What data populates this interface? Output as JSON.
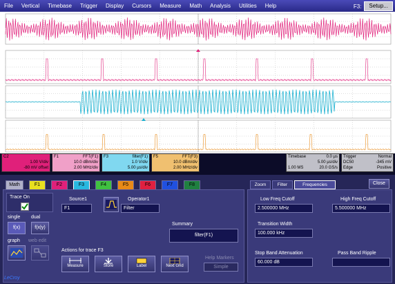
{
  "menu": [
    "File",
    "Vertical",
    "Timebase",
    "Trigger",
    "Display",
    "Cursors",
    "Measure",
    "Math",
    "Analysis",
    "Utilities",
    "Help"
  ],
  "setup": {
    "prefix": "F3:",
    "label": "Setup..."
  },
  "channels": [
    {
      "id": "C2",
      "color": "#e0207a"
    },
    {
      "id": "F1",
      "color": "#e0207a"
    },
    {
      "id": "F3",
      "color": "#18b0d0"
    },
    {
      "id": "F5",
      "color": "#e88a18"
    }
  ],
  "desc_boxes": [
    {
      "id": "C2",
      "title": "",
      "vals": [
        "1.00 V/div",
        "-80 mV offset"
      ],
      "color": "#e0207a",
      "text": "#000"
    },
    {
      "id": "F1",
      "title": "FFT(F1)",
      "vals": [
        "10.0 dBm/div",
        "2.00 MHz/div"
      ],
      "color": "#f0a0c8",
      "text": "#000"
    },
    {
      "id": "F3",
      "title": "filter(F1)",
      "vals": [
        "1.0 V/div",
        "5.00 µs/div"
      ],
      "color": "#80d8f0",
      "text": "#000"
    },
    {
      "id": "F5",
      "title": "FFT(F3)",
      "vals": [
        "10.0 dBm/div",
        "2.00 MHz/div"
      ],
      "color": "#f0c070",
      "text": "#000"
    }
  ],
  "timebase": {
    "label": "Timebase",
    "rows": [
      [
        "",
        "0.0 µs"
      ],
      [
        "",
        "5.00 µs/div"
      ],
      [
        "1.00 MS",
        "20.0 GS/s"
      ]
    ]
  },
  "trigger": {
    "label": "Trigger",
    "mode": "Normal",
    "rows": [
      [
        "DC50",
        "-345 mV"
      ],
      [
        "Edge",
        "Positive"
      ]
    ]
  },
  "dialog": {
    "tabs": [
      "Math",
      "F1",
      "F2",
      "F3",
      "F4",
      "F5",
      "F6",
      "F7",
      "F8"
    ],
    "trace_on": {
      "label": "Trace On",
      "checked": true
    },
    "single_label": "single",
    "dual_label": "dual",
    "graph_label": "graph",
    "web_edit_label": "web edit",
    "source_label": "Source1",
    "source_value": "F1",
    "operator_label": "Operator1",
    "operator_value": "Filter",
    "summary_label": "Summary",
    "summary_value": "filter(F1)",
    "actions_label": "Actions for trace F3",
    "actions": [
      "Measure",
      "Store",
      "Label",
      "Next Grid"
    ],
    "help_markers_label": "Help Markers",
    "help_markers_value": "Simple"
  },
  "right_panel": {
    "tabs": [
      "Zoom",
      "Filter",
      "Frequencies"
    ],
    "close": "Close",
    "low_cut_label": "Low Freq Cutoff",
    "low_cut_value": "2.500000 MHz",
    "high_cut_label": "High Freq Cutoff",
    "high_cut_value": "5.500000 MHz",
    "transition_label": "Transition Width",
    "transition_value": "100.000 kHz",
    "stop_label": "Stop Band Attenuation",
    "stop_value": "60.000 dB",
    "pass_label": "Pass Band Ripple"
  },
  "brand": "LeCroy"
}
